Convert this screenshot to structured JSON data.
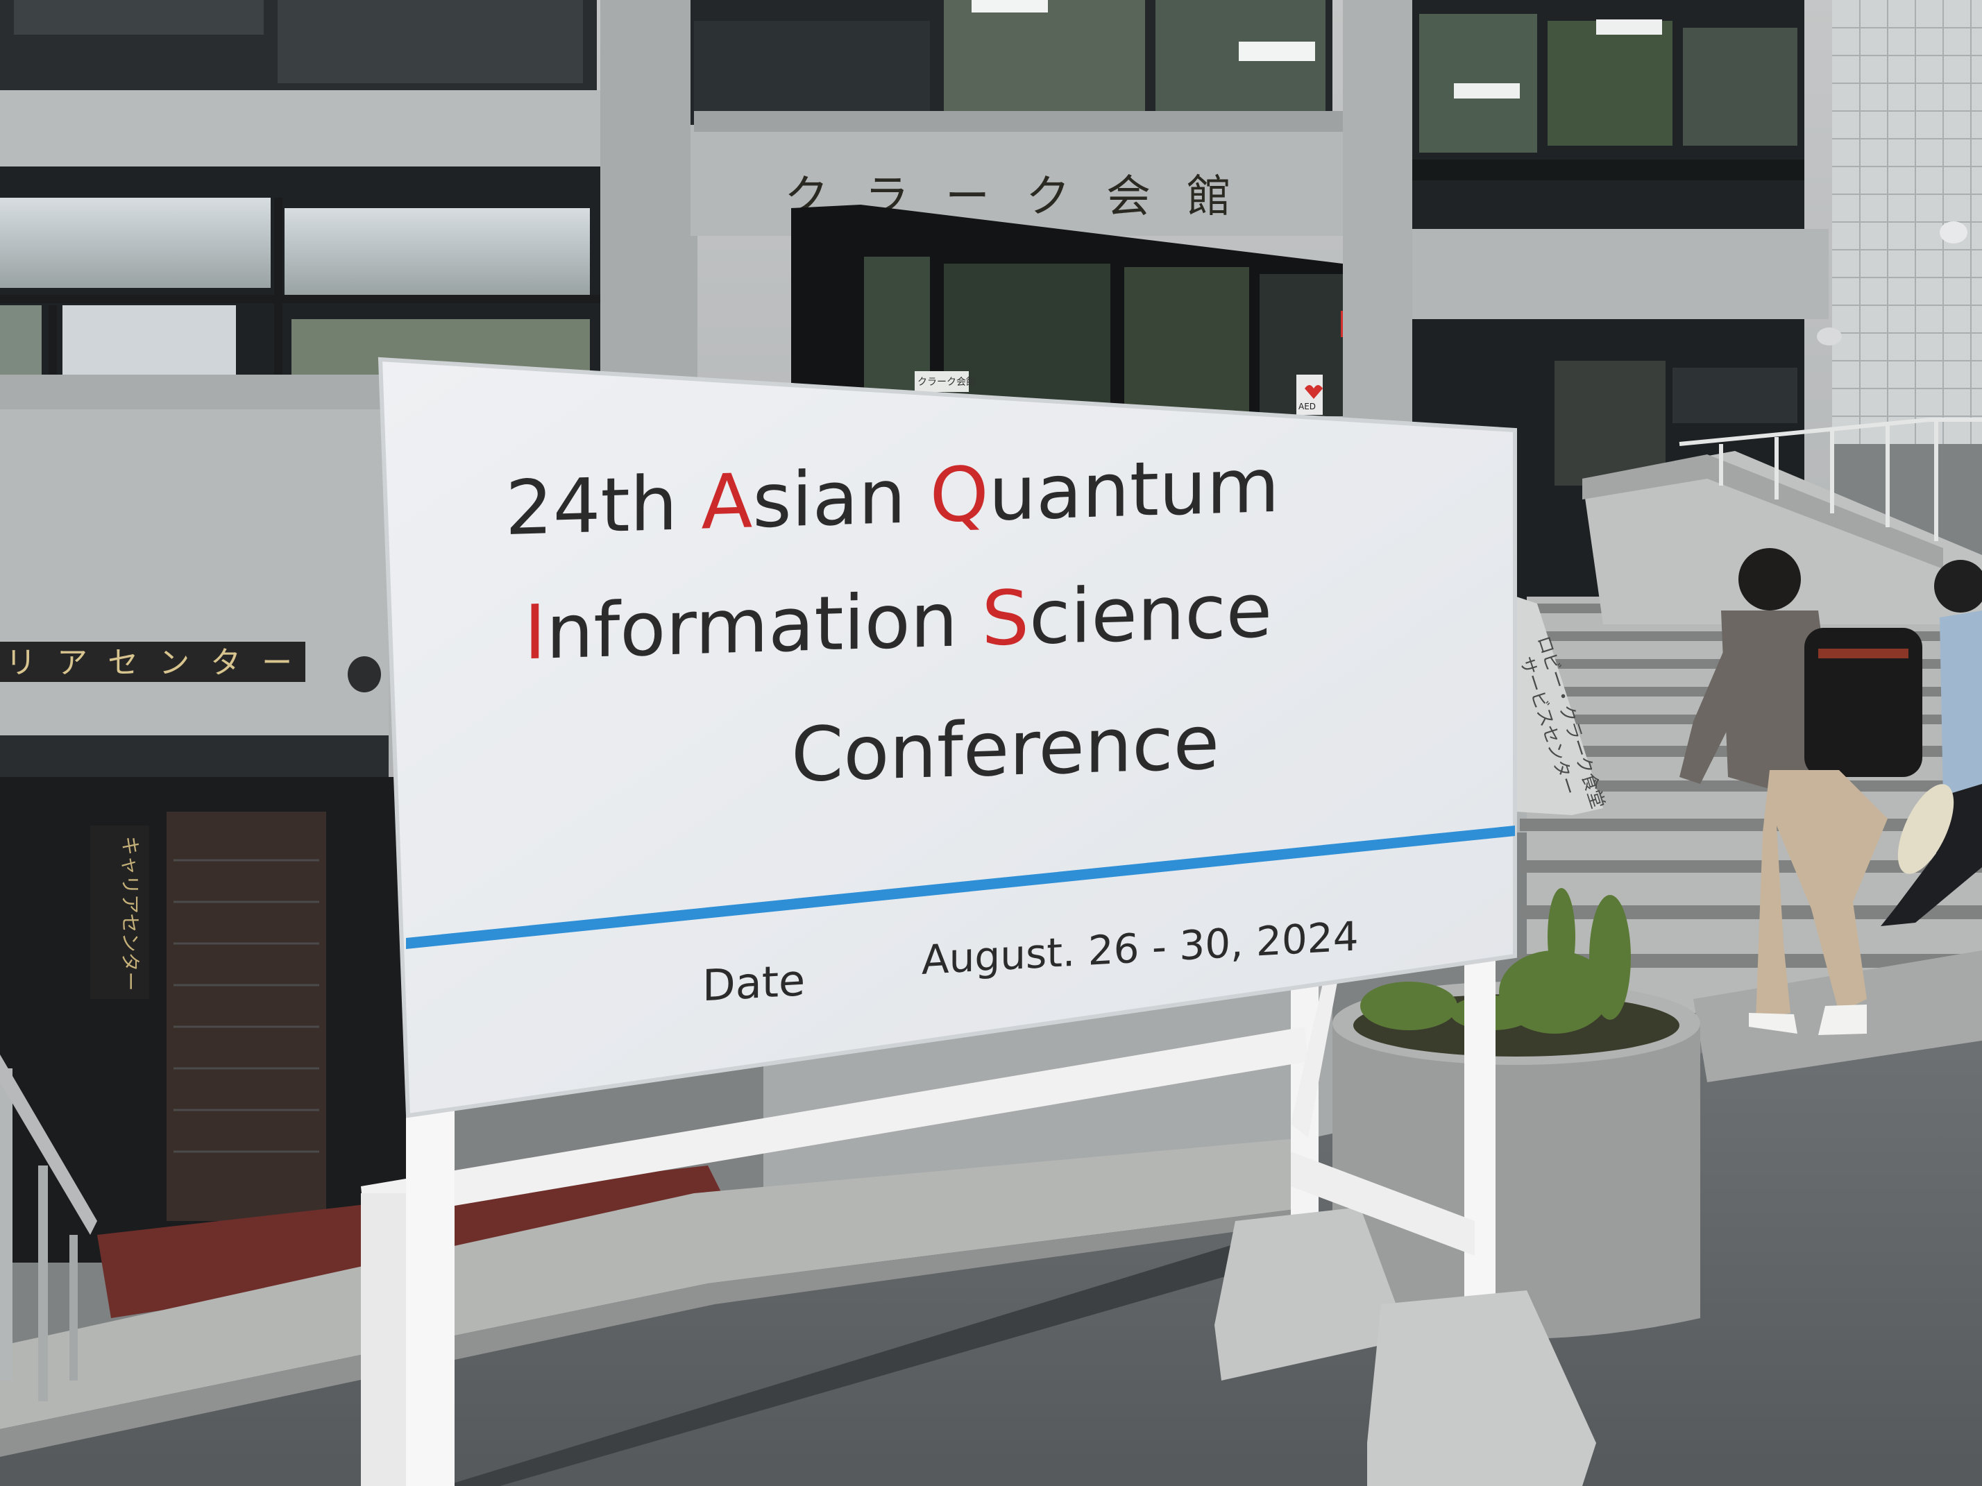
{
  "building": {
    "facade_sign": "クラーク会館",
    "center_sign": "リアセンター",
    "door_plaque": "クラーク会館",
    "aed_label": "AED",
    "left_vertical_sign": "キャリアセンター",
    "stair_sign_line1": "ロビー・クラーク食堂",
    "stair_sign_line2": "サービスセンター"
  },
  "sign": {
    "title_line1": {
      "prefix": "24th ",
      "a_initial": "A",
      "a_rest": "sian ",
      "q_initial": "Q",
      "q_rest": "uantum"
    },
    "title_line2": {
      "i_initial": "I",
      "i_rest": "nformation ",
      "s_initial": "S",
      "s_rest": "cience"
    },
    "title_line3": "Conference",
    "date_label": "Date",
    "date_value": "August. 26 - 30, 2024"
  },
  "colors": {
    "sign_background": "#e9ebee",
    "title_text": "#2b2b2b",
    "initial_highlight": "#cc2a2a",
    "divider_line": "#2f8fd6",
    "sky_reflection": "#d6dce0",
    "building_concrete": "#b9bcbd"
  }
}
